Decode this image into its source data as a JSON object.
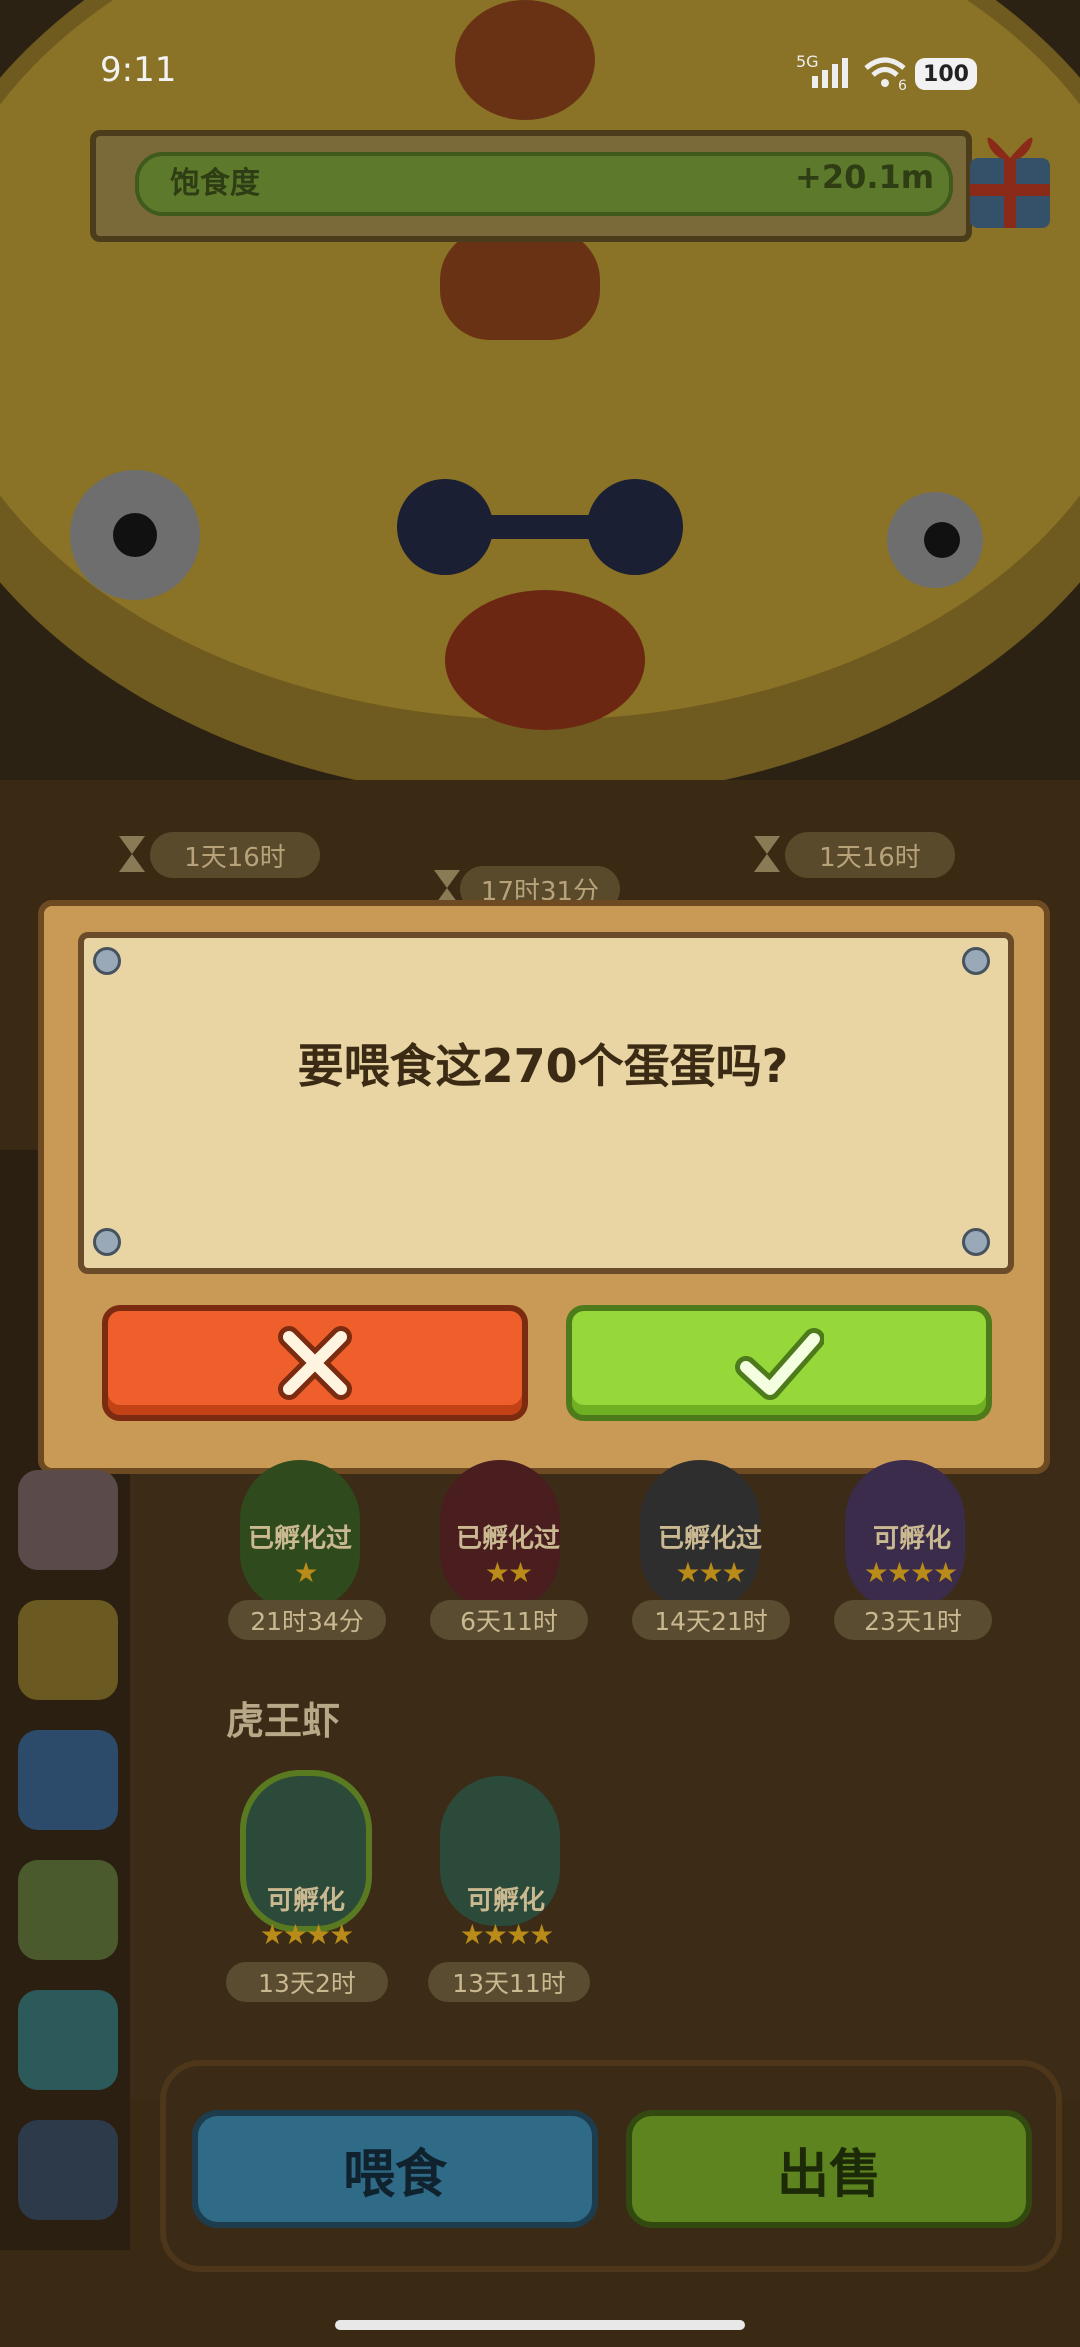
{
  "status_bar": {
    "time": "9:11",
    "network": "5G",
    "wifi_level": "6",
    "battery": "100"
  },
  "satiety": {
    "label": "饱食度",
    "value": "+20.1m",
    "fill_percent": 100
  },
  "timers_top": [
    "1天16时",
    "17时31分",
    "1天16时"
  ],
  "dialog": {
    "message": "要喂食这270个蛋蛋吗?",
    "cancel_icon": "close-icon",
    "confirm_icon": "check-icon"
  },
  "eggs_row1": [
    {
      "status": "已孵化过",
      "stars": "★",
      "time": "21时34分"
    },
    {
      "status": "已孵化过",
      "stars": "★★",
      "time": "6天11时"
    },
    {
      "status": "已孵化过",
      "stars": "★★★",
      "time": "14天21时"
    },
    {
      "status": "可孵化",
      "stars": "★★★★",
      "time": "23天1时"
    }
  ],
  "section": {
    "title": "虎王虾"
  },
  "eggs_row2": [
    {
      "status": "可孵化",
      "stars": "★★★★",
      "time": "13天2时"
    },
    {
      "status": "可孵化",
      "stars": "★★★★",
      "time": "13天11时"
    }
  ],
  "bottom": {
    "feed_label": "喂食",
    "sell_label": "出售"
  },
  "colors": {
    "cancel": "#ee5f2c",
    "confirm": "#96d83a",
    "feed": "#2f6a86",
    "sell": "#5e8420"
  }
}
